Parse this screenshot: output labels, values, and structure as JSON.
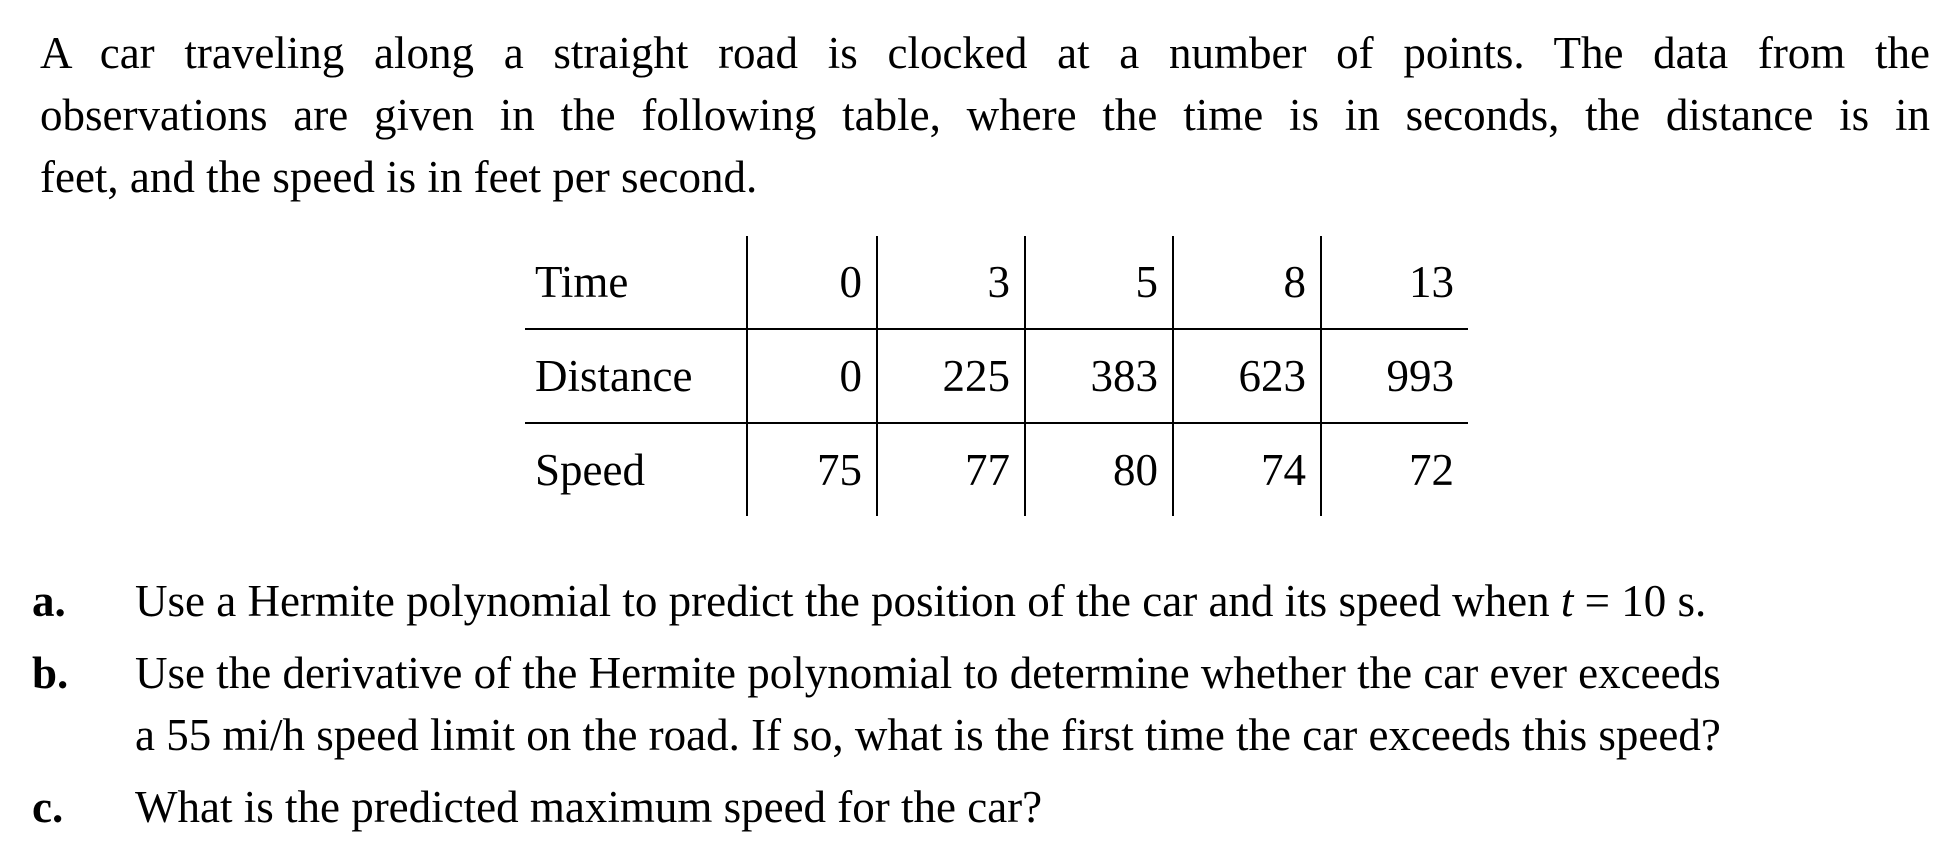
{
  "intro": {
    "line1": "A car traveling along a straight road is clocked at a number of points. The data from the",
    "line2": "observations are given in the following table, where the time is in seconds, the distance is in",
    "line3": "feet, and the speed is in feet per second."
  },
  "table": {
    "rows": [
      {
        "label": "Time",
        "values": [
          "0",
          "3",
          "5",
          "8",
          "13"
        ]
      },
      {
        "label": "Distance",
        "values": [
          "0",
          "225",
          "383",
          "623",
          "993"
        ]
      },
      {
        "label": "Speed",
        "values": [
          "75",
          "77",
          "80",
          "74",
          "72"
        ]
      }
    ]
  },
  "questions": {
    "a": {
      "letter": "a.",
      "text_before": "Use a Hermite polynomial to predict the position of the car and its speed when ",
      "var": "t",
      "text_after": " = 10 s."
    },
    "b": {
      "letter": "b.",
      "line1": "Use the derivative of the Hermite polynomial to determine whether the car ever exceeds",
      "line2": "a 55 mi/h speed limit on the road. If so, what is the first time the car exceeds this speed?"
    },
    "c": {
      "letter": "c.",
      "text": "What is the predicted maximum speed for the car?"
    }
  }
}
